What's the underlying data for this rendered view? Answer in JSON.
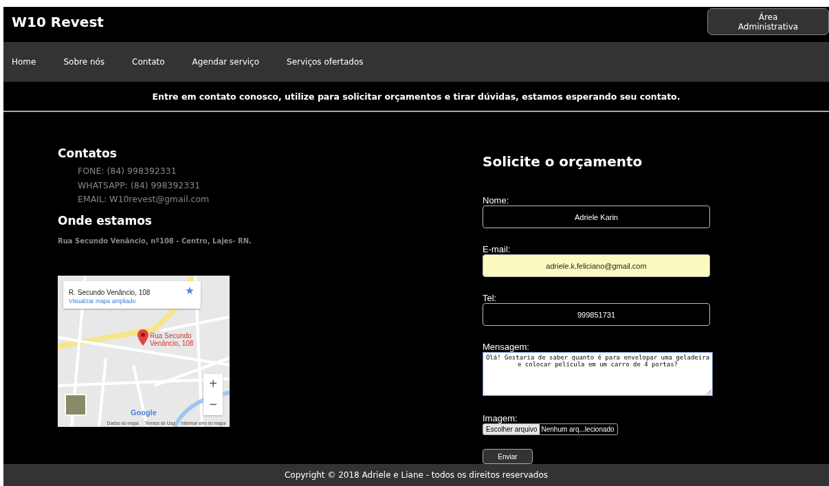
{
  "header": {
    "brand": "W10 Revest",
    "admin_button": "Área Administrativa"
  },
  "nav": {
    "items": [
      {
        "label": "Home"
      },
      {
        "label": "Sobre nós"
      },
      {
        "label": "Contato"
      },
      {
        "label": "Agendar serviço"
      },
      {
        "label": "Serviços ofertados"
      }
    ]
  },
  "banner": "Entre em contato conosco, utilize para solicitar orçamentos e tirar dúvidas, estamos esperando seu contato.",
  "contacts": {
    "title": "Contatos",
    "items": [
      "FONE: (84) 998392331",
      "WHATSAPP: (84) 998392331",
      "EMAIL: W10revest@gmail.com"
    ],
    "location_title": "Onde estamos",
    "address": "Rua Secundo Venâncio, nº108 - Centro, Lajes- RN."
  },
  "map": {
    "place_title": "R. Secundo Venâncio, 108",
    "larger_map_link": "Visualizar mapa ampliado",
    "pin_label": "Rua Secundo Venâncio, 108",
    "zoom_in": "+",
    "zoom_out": "−",
    "logo": "Google",
    "footer_links": [
      "Dados do mapa",
      "Termos de Uso",
      "Informar erro no mapa"
    ]
  },
  "form": {
    "title": "Solicite o orçamento",
    "fields": [
      {
        "label": "Nome:",
        "value": "Adriele Karin",
        "autofilled": false
      },
      {
        "label": "E-mail:",
        "value": "adriele.k.feliciano@gmail.com",
        "autofilled": true
      },
      {
        "label": "Tel:",
        "value": "999851731",
        "autofilled": false
      }
    ],
    "message": {
      "label": "Mensagem:",
      "value": "Olá! Gostaria de saber quanto é para envelopar uma geladeira e colocar película em um carro de 4 portas?"
    },
    "image": {
      "label": "Imagem:",
      "button": "Escolher arquivo",
      "status": "Nenhum arq...lecionado"
    },
    "submit": "Enviar"
  },
  "footer": "Copyright © 2018 Adriele e Liane - todos os direitos reservados"
}
